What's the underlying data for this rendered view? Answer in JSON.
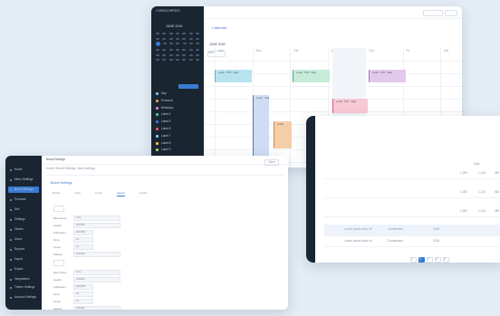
{
  "calendar_window": {
    "app_title": "CYBERCORPSES",
    "month_label": "JUNE 2016",
    "title": "Calendar",
    "week_label": "JUNE 2016",
    "timezone_label": "GMT",
    "weekdays": [
      "Sun",
      "Mon",
      "Tue",
      "Wed",
      "Thu",
      "Fri",
      "Sat"
    ],
    "calendars": [
      {
        "label": "Day",
        "color": "#7ac4e8"
      },
      {
        "label": "Personal",
        "color": "#e39b60"
      },
      {
        "label": "Birthdays",
        "color": "#c889d6"
      },
      {
        "label": "Label 4",
        "color": "#5fc59a"
      },
      {
        "label": "Label 5",
        "color": "#3a7bd5"
      },
      {
        "label": "Label 6",
        "color": "#e05a7a"
      },
      {
        "label": "Label 7",
        "color": "#8ec9ef"
      },
      {
        "label": "Label 8",
        "color": "#f0c24a"
      },
      {
        "label": "Label 9",
        "color": "#9cd86a"
      }
    ],
    "events": [
      {
        "label": "Lunch · PTP · Start",
        "color": "#b7e3ee"
      },
      {
        "label": "Lunch · PTP · Start",
        "color": "#c6ecd9"
      },
      {
        "label": "Lunch · PTP · Start",
        "color": "#e2c9ec"
      },
      {
        "label": "Lunch · Call",
        "color": "#cfdcf3"
      },
      {
        "label": "Lunch",
        "color": "#f4cda9"
      },
      {
        "label": "Lunch · PTP · Start",
        "color": "#f6c9d3"
      },
      {
        "label": "Lunch · PTP · Start",
        "color": "#cfe9d6"
      },
      {
        "label": "Lunch · PTP",
        "color": "#e6eaf0"
      },
      {
        "label": "Lunch · PTP",
        "color": "#e6eaf0"
      },
      {
        "label": "Lunch · PTP",
        "color": "#e6eaf0"
      }
    ]
  },
  "settings_window": {
    "header_title": "Brand Settings",
    "breadcrumb": "Home / Brand Settings / Main Settings",
    "panel_title": "Brand Settings",
    "tabs": [
      "Brand",
      "Color",
      "Fonts",
      "Layout",
      "Locale"
    ],
    "sidebar_items": [
      "Home",
      "Menu Settings",
      "Brand Settings",
      "Products",
      "Sell",
      "Settings",
      "Orders",
      "Users",
      "Reports",
      "Import",
      "Export",
      "Integrations",
      "Theme Settings",
      "Account Settings"
    ],
    "fields": [
      {
        "label": "Base Name",
        "value": "Corp"
      },
      {
        "label": "Header",
        "value": "#1A2532"
      },
      {
        "label": "Subheader",
        "value": "#3A7BD5"
      },
      {
        "label": "Menu",
        "value": "On"
      },
      {
        "label": "Footer",
        "value": "On"
      },
      {
        "label": "Sidebar",
        "value": "#1A2532"
      },
      {
        "label": "Base Name",
        "value": "Corp"
      },
      {
        "label": "Header",
        "value": "#1A2532"
      },
      {
        "label": "Subheader",
        "value": "#3A7BD5"
      },
      {
        "label": "Menu",
        "value": "On"
      },
      {
        "label": "Footer",
        "value": "On"
      },
      {
        "label": "Sidebar",
        "value": "#1A2532"
      }
    ],
    "save_label": "Save"
  },
  "table_window": {
    "header": "Date",
    "rows": [
      {
        "c1": "1,280",
        "c2": "1,120",
        "c3": "980"
      },
      {
        "c1": "1,280",
        "c2": "1,120",
        "c3": "980"
      },
      {
        "c1": "1,280",
        "c2": "1,120",
        "c3": "980"
      },
      {
        "c1": "1,280",
        "c2": "1,120",
        "c3": "980"
      },
      {
        "c1": "Lorem ipsum dolor sit",
        "c2": "Consectetur",
        "c3": "2016"
      },
      {
        "c1": "Lorem ipsum dolor sit",
        "c2": "Consectetur",
        "c3": "2016"
      }
    ],
    "pages": [
      "1",
      "2",
      "3",
      "4",
      "5"
    ]
  }
}
